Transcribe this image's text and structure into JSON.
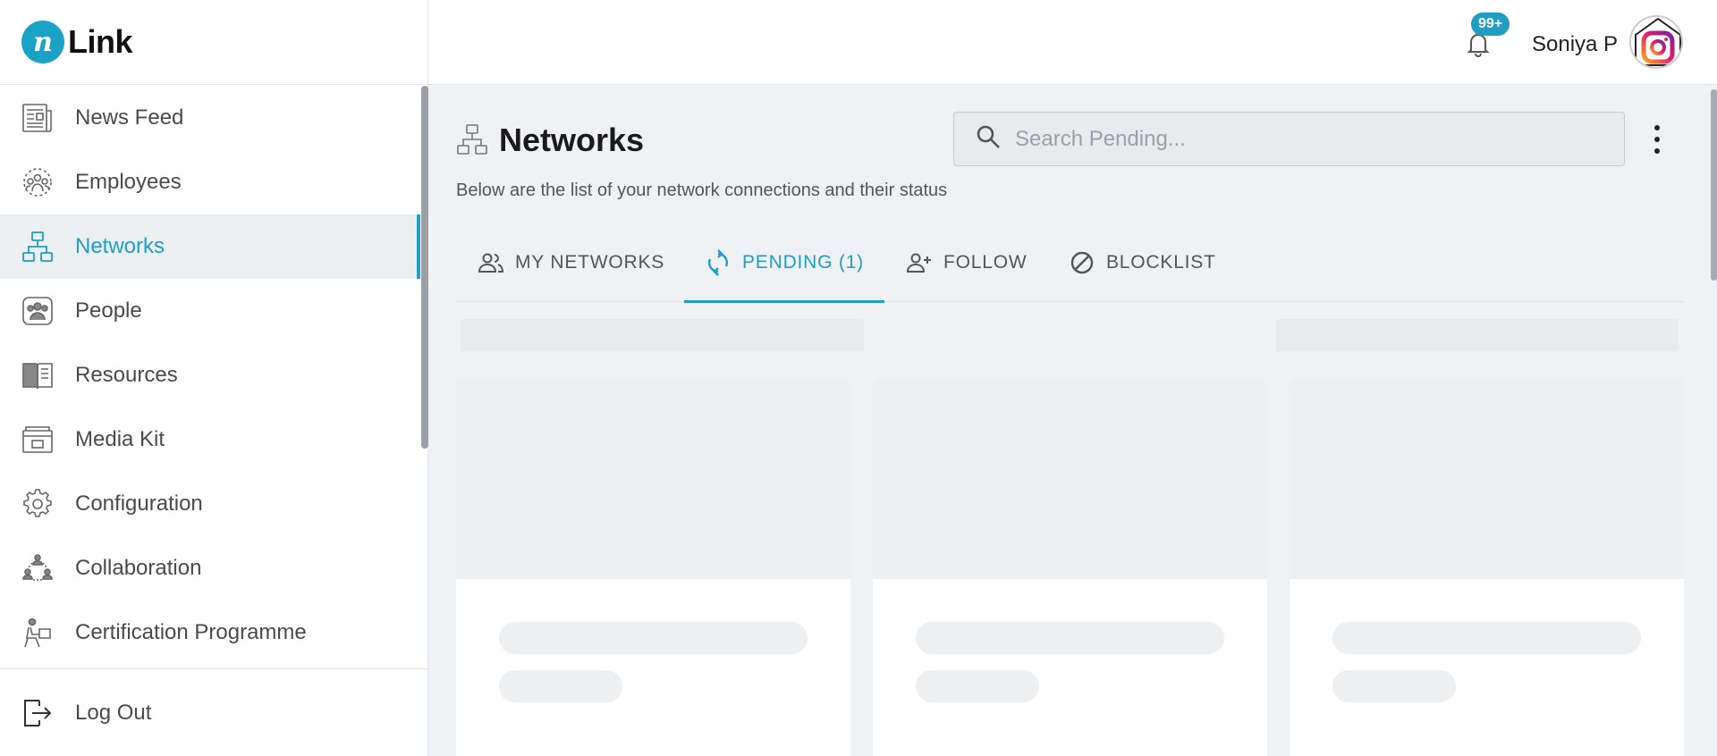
{
  "brand": {
    "mark": "n",
    "name": "Link",
    "accent": "#1f9ec2"
  },
  "sidebar": {
    "items": [
      {
        "label": "News Feed",
        "icon": "newspaper-icon"
      },
      {
        "label": "Employees",
        "icon": "employees-icon"
      },
      {
        "label": "Networks",
        "icon": "network-icon",
        "active": true
      },
      {
        "label": "People",
        "icon": "people-icon"
      },
      {
        "label": "Resources",
        "icon": "book-icon"
      },
      {
        "label": "Media Kit",
        "icon": "media-kit-icon"
      },
      {
        "label": "Configuration",
        "icon": "gear-icon"
      },
      {
        "label": "Collaboration",
        "icon": "collaboration-icon"
      },
      {
        "label": "Certification Programme",
        "icon": "certification-icon"
      }
    ],
    "logout_label": "Log Out"
  },
  "header": {
    "notifications_badge": "99+",
    "user_name": "Soniya P"
  },
  "page": {
    "title": "Networks",
    "subtitle": "Below are the list of your network connections and their status",
    "search_placeholder": "Search Pending..."
  },
  "tabs": [
    {
      "label": "MY NETWORKS",
      "icon": "people-outline-icon"
    },
    {
      "label": "PENDING (1)",
      "icon": "sync-icon",
      "active": true
    },
    {
      "label": "FOLLOW",
      "icon": "person-add-icon"
    },
    {
      "label": "BLOCKLIST",
      "icon": "block-icon"
    }
  ]
}
